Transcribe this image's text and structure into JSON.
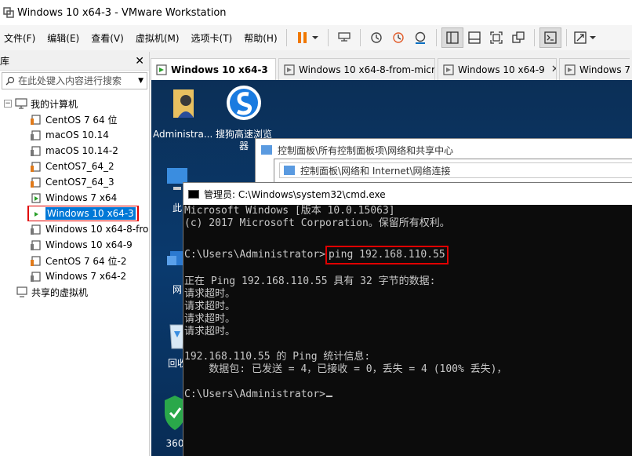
{
  "window": {
    "title": "Windows 10 x64-3 - VMware Workstation"
  },
  "menu": [
    "文件(F)",
    "编辑(E)",
    "查看(V)",
    "虚拟机(M)",
    "选项卡(T)",
    "帮助(H)"
  ],
  "library": {
    "title": "库",
    "search_placeholder": "在此处键入内容进行搜索",
    "root": "我的计算机",
    "items": [
      "CentOS 7 64 位",
      "macOS 10.14",
      "macOS 10.14-2",
      "CentOS7_64_2",
      "CentOS7_64_3",
      "Windows 7 x64",
      "Windows 10 x64-3",
      "Windows 10 x64-8-fro",
      "Windows 10 x64-9",
      "CentOS 7 64 位-2",
      "Windows 7 x64-2"
    ],
    "shared": "共享的虚拟机"
  },
  "tabs": [
    "Windows 10 x64-3",
    "Windows 10 x64-8-from-micro...",
    "Windows 10 x64-9",
    "Windows 7 x"
  ],
  "desktop": {
    "icons": [
      "Administra...",
      "搜狗高速浏览器",
      "此",
      "网",
      "回收",
      "360"
    ]
  },
  "explorer1": {
    "address": "控制面板\\所有控制面板项\\网络和共享中心"
  },
  "explorer2": {
    "address": "控制面板\\网络和 Internet\\网络连接"
  },
  "cmd": {
    "title": "管理员: C:\\Windows\\system32\\cmd.exe",
    "line1": "Microsoft Windows [版本 10.0.15063]",
    "line2": "(c) 2017 Microsoft Corporation。保留所有权利。",
    "prompt": "C:\\Users\\Administrator>",
    "command": "ping 192.168.110.55",
    "ping_header": "正在 Ping 192.168.110.55 具有 32 字节的数据:",
    "timeout": "请求超时。",
    "stats_header": "192.168.110.55 的 Ping 统计信息:",
    "stats_packets": "    数据包: 已发送 = 4，已接收 = 0，丢失 = 4 (100% 丢失)，",
    "final_prompt": "C:\\Users\\Administrator>"
  },
  "colors": {
    "highlight_red": "#e00000",
    "selection_blue": "#0078d7",
    "cmd_bg": "#0c0c0c",
    "desktop_bg": "#0a3a6e"
  }
}
